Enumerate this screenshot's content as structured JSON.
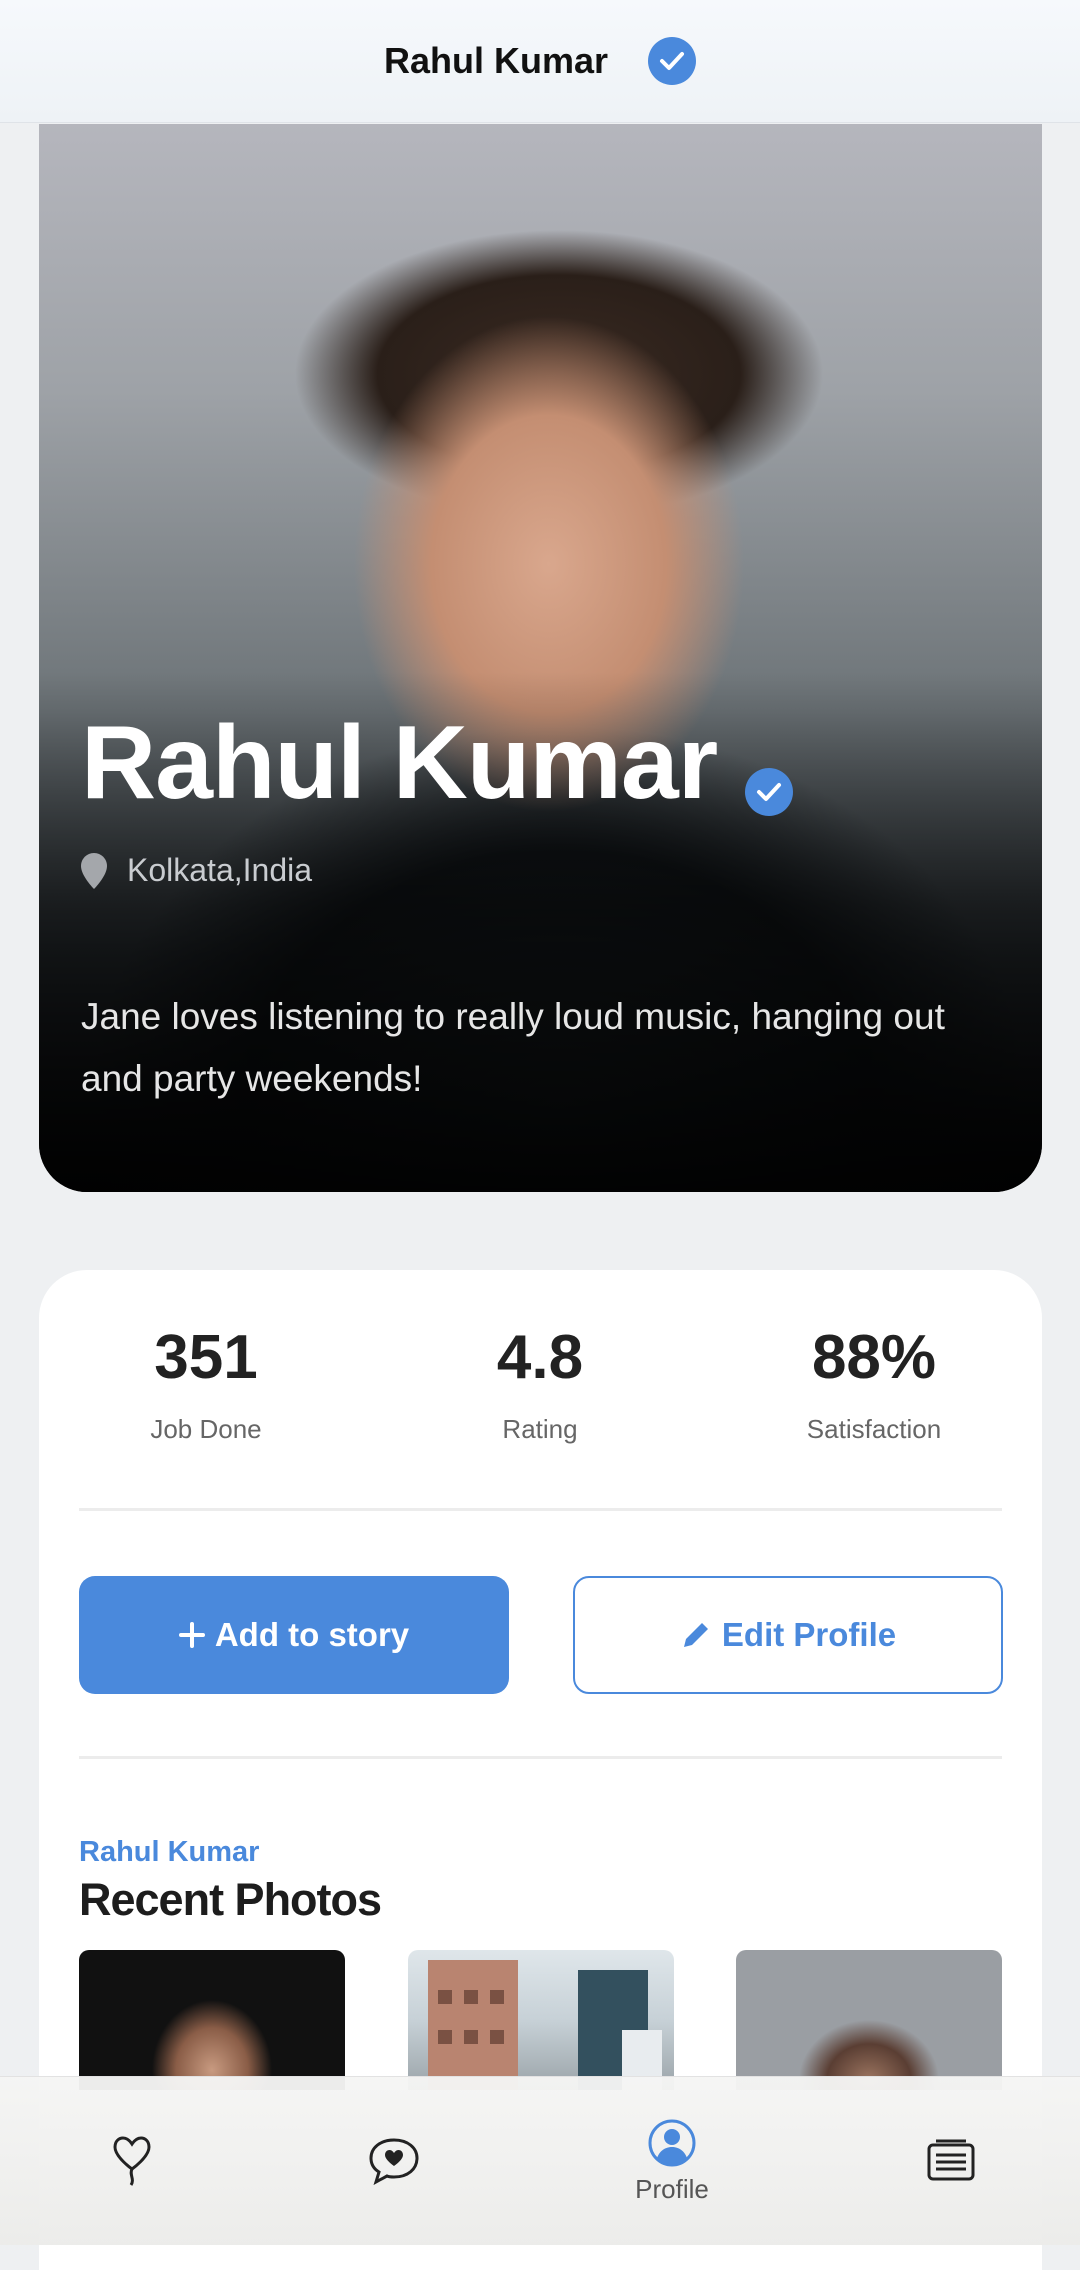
{
  "header": {
    "title": "Rahul Kumar"
  },
  "profile": {
    "name": "Rahul Kumar",
    "location": "Kolkata,India",
    "bio": "Jane loves listening to really loud music, hanging out and party weekends!"
  },
  "stats": [
    {
      "value": "351",
      "label": "Job Done"
    },
    {
      "value": "4.8",
      "label": "Rating"
    },
    {
      "value": "88%",
      "label": "Satisfaction"
    }
  ],
  "actions": {
    "add_story": "Add to story",
    "edit_profile": "Edit Profile"
  },
  "photos_section": {
    "subtitle": "Rahul Kumar",
    "title": "Recent Photos"
  },
  "bottom_nav": {
    "items": [
      {
        "icon": "heart-balloon-icon",
        "label": ""
      },
      {
        "icon": "chat-heart-icon",
        "label": ""
      },
      {
        "icon": "profile-icon",
        "label": "Profile",
        "active": true
      },
      {
        "icon": "news-icon",
        "label": ""
      }
    ]
  },
  "colors": {
    "accent": "#4a89dc",
    "text": "#222222",
    "muted": "#666666"
  }
}
